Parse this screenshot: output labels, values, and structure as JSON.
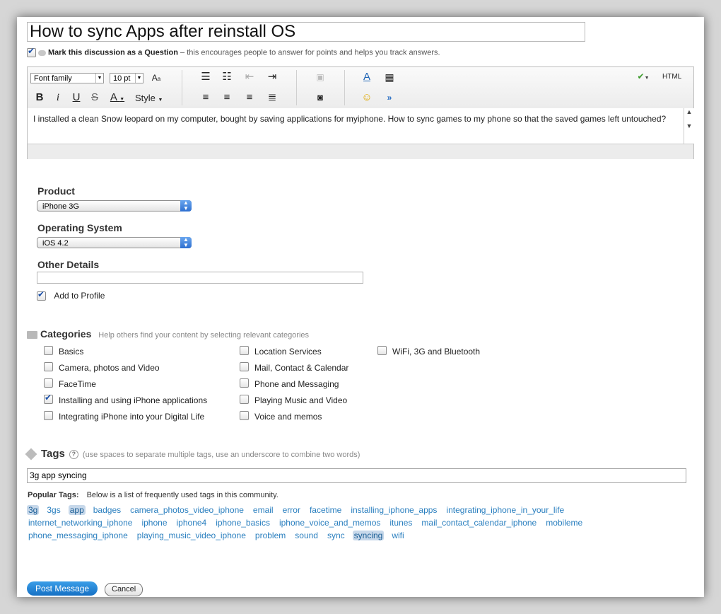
{
  "title_value": "How to sync Apps after reinstall OS",
  "question": {
    "bold": "Mark this discussion as a Question",
    "rest": " – this encourages people to answer for points and helps you track answers."
  },
  "editor": {
    "font_family": "Font family",
    "font_size": "10 pt",
    "style_label": "Style",
    "html_label": "HTML",
    "body_text": "I installed a clean Snow leopard on my computer, bought by saving applications for myiphone. How to sync games to my phone so that the saved games left untouched?"
  },
  "product": {
    "label": "Product",
    "value": "iPhone 3G"
  },
  "os": {
    "label": "Operating System",
    "value": "iOS 4.2"
  },
  "other_details": {
    "label": "Other Details",
    "value": ""
  },
  "add_to_profile": "Add to Profile",
  "categories": {
    "label": "Categories",
    "hint": "Help others find your content by selecting relevant categories",
    "items": [
      {
        "label": "Basics",
        "checked": false
      },
      {
        "label": "Camera, photos and Video",
        "checked": false
      },
      {
        "label": "FaceTime",
        "checked": false
      },
      {
        "label": "Installing and using iPhone applications",
        "checked": true
      },
      {
        "label": "Integrating iPhone into your Digital Life",
        "checked": false
      },
      {
        "label": "Location Services",
        "checked": false
      },
      {
        "label": "Mail, Contact & Calendar",
        "checked": false
      },
      {
        "label": "Phone and Messaging",
        "checked": false
      },
      {
        "label": "Playing Music and Video",
        "checked": false
      },
      {
        "label": "Voice and memos",
        "checked": false
      },
      {
        "label": "WiFi, 3G and Bluetooth",
        "checked": false
      }
    ]
  },
  "tags": {
    "label": "Tags",
    "hint": "(use spaces to separate multiple tags, use an underscore to combine two words)",
    "value": "3g app syncing",
    "popular_label": "Popular Tags:",
    "popular_desc": "Below is a list of frequently used tags in this community.",
    "popular": [
      [
        "3g",
        "3gs",
        "app",
        "badges",
        "camera_photos_video_iphone",
        "email",
        "error",
        "facetime",
        "installing_iphone_apps",
        "integrating_iphone_in_your_life"
      ],
      [
        "internet_networking_iphone",
        "iphone",
        "iphone4",
        "iphone_basics",
        "iphone_voice_and_memos",
        "itunes",
        "mail_contact_calendar_iphone",
        "mobileme"
      ],
      [
        "phone_messaging_iphone",
        "playing_music_video_iphone",
        "problem",
        "sound",
        "sync",
        "syncing",
        "wifi"
      ]
    ],
    "selected": [
      "3g",
      "app",
      "syncing"
    ]
  },
  "buttons": {
    "post": "Post Message",
    "cancel": "Cancel"
  }
}
